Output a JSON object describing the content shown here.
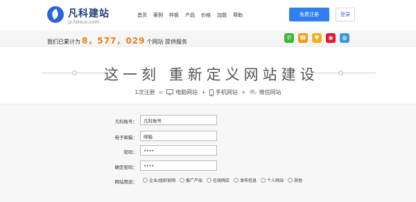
{
  "header": {
    "logo_name": "凡科建站",
    "logo_sub": "jz.faisco.com",
    "nav": [
      "首页",
      "案例",
      "样板",
      "产品",
      "价格",
      "加盟",
      "帮助"
    ],
    "register_label": "免费注册",
    "login_label": "登录"
  },
  "stats": {
    "prefix": "我们已累计为",
    "count": "8，577，029",
    "suffix": "个网站 提供服务"
  },
  "socials": [
    {
      "icon": "wechat-icon",
      "color": "#3fb83a",
      "glyph": "✆"
    },
    {
      "icon": "phone-icon",
      "color": "#f39a1b",
      "glyph": "☎"
    },
    {
      "icon": "favorite-icon",
      "color": "#f2b21b",
      "glyph": "♥"
    },
    {
      "icon": "weibo-icon",
      "color": "#e6162d",
      "glyph": "◉"
    },
    {
      "icon": "tencent-weibo-icon",
      "color": "#3a9ad9",
      "glyph": "◍"
    }
  ],
  "slogan": {
    "title": "这一刻  重新定义网站建设",
    "step1": "1次注册",
    "eq": "=",
    "pc": "电脑网站",
    "plus1": "+",
    "mobile": "手机网站",
    "plus2": "+",
    "weixin": "微信网站"
  },
  "form": {
    "fields": [
      {
        "label": "凡科账号：",
        "value": "凡科账号"
      },
      {
        "label": "电子邮箱：",
        "value": "邮箱"
      },
      {
        "label": "密码：",
        "value": "••••"
      },
      {
        "label": "确定密码：",
        "value": "••••"
      }
    ],
    "purpose_label": "网站用途：",
    "purpose_options": [
      "企业/组织官网",
      "推广产品",
      "在线网店",
      "发布信息",
      "个人网站",
      "其他"
    ]
  },
  "colors": {
    "accent": "#2f7ff0",
    "count": "#ef7a14"
  }
}
